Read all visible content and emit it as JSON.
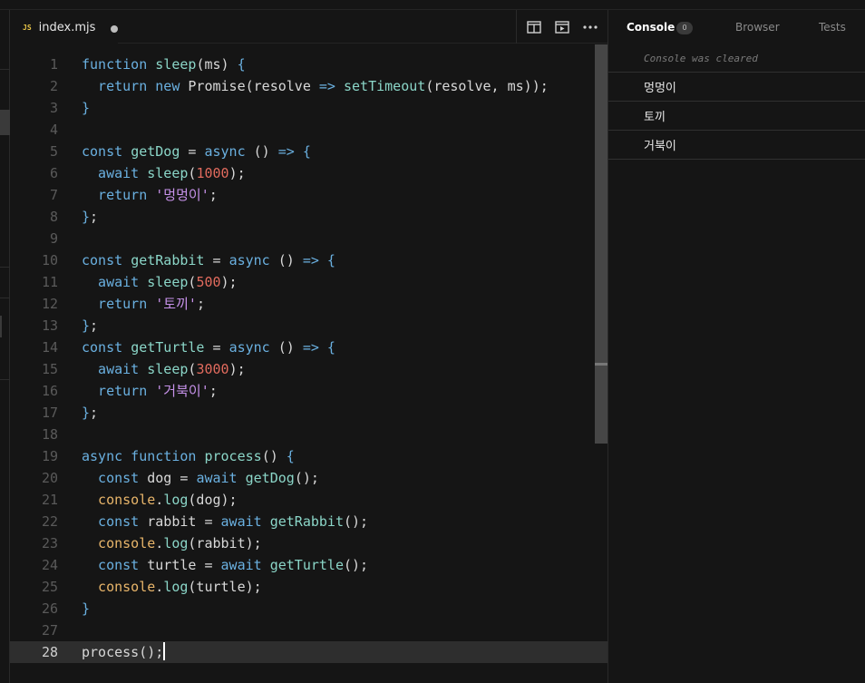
{
  "editor": {
    "tab": {
      "lang_badge": "JS",
      "filename": "index.mjs"
    },
    "actions": [
      "split-editor-icon",
      "open-preview-icon",
      "more-icon"
    ],
    "lines": [
      {
        "n": "1",
        "tokens": [
          [
            "kw",
            "function "
          ],
          [
            "fn",
            "sleep"
          ],
          [
            "cls",
            "(ms) "
          ],
          [
            "kw",
            "{"
          ]
        ]
      },
      {
        "n": "2",
        "tokens": [
          [
            "kw",
            "  return new "
          ],
          [
            "cls",
            "Promise(resolve "
          ],
          [
            "kw",
            "=> "
          ],
          [
            "fn",
            "setTimeout"
          ],
          [
            "cls",
            "(resolve, ms));"
          ]
        ]
      },
      {
        "n": "3",
        "tokens": [
          [
            "kw",
            "}"
          ]
        ]
      },
      {
        "n": "4",
        "tokens": []
      },
      {
        "n": "5",
        "tokens": [
          [
            "kw",
            "const "
          ],
          [
            "fn",
            "getDog "
          ],
          [
            "cls",
            "= "
          ],
          [
            "kw",
            "async "
          ],
          [
            "cls",
            "() "
          ],
          [
            "kw",
            "=> {"
          ]
        ]
      },
      {
        "n": "6",
        "tokens": [
          [
            "kw",
            "  await "
          ],
          [
            "fn",
            "sleep"
          ],
          [
            "cls",
            "("
          ],
          [
            "num",
            "1000"
          ],
          [
            "cls",
            ");"
          ]
        ]
      },
      {
        "n": "7",
        "tokens": [
          [
            "kw",
            "  return "
          ],
          [
            "str",
            "'멍멍이'"
          ],
          [
            "cls",
            ";"
          ]
        ]
      },
      {
        "n": "8",
        "tokens": [
          [
            "kw",
            "}"
          ],
          [
            "cls",
            ";"
          ]
        ]
      },
      {
        "n": "9",
        "tokens": []
      },
      {
        "n": "10",
        "tokens": [
          [
            "kw",
            "const "
          ],
          [
            "fn",
            "getRabbit "
          ],
          [
            "cls",
            "= "
          ],
          [
            "kw",
            "async "
          ],
          [
            "cls",
            "() "
          ],
          [
            "kw",
            "=> {"
          ]
        ]
      },
      {
        "n": "11",
        "tokens": [
          [
            "kw",
            "  await "
          ],
          [
            "fn",
            "sleep"
          ],
          [
            "cls",
            "("
          ],
          [
            "num",
            "500"
          ],
          [
            "cls",
            ");"
          ]
        ]
      },
      {
        "n": "12",
        "tokens": [
          [
            "kw",
            "  return "
          ],
          [
            "str",
            "'토끼'"
          ],
          [
            "cls",
            ";"
          ]
        ]
      },
      {
        "n": "13",
        "tokens": [
          [
            "kw",
            "}"
          ],
          [
            "cls",
            ";"
          ]
        ]
      },
      {
        "n": "14",
        "tokens": [
          [
            "kw",
            "const "
          ],
          [
            "fn",
            "getTurtle "
          ],
          [
            "cls",
            "= "
          ],
          [
            "kw",
            "async "
          ],
          [
            "cls",
            "() "
          ],
          [
            "kw",
            "=> {"
          ]
        ]
      },
      {
        "n": "15",
        "tokens": [
          [
            "kw",
            "  await "
          ],
          [
            "fn",
            "sleep"
          ],
          [
            "cls",
            "("
          ],
          [
            "num",
            "3000"
          ],
          [
            "cls",
            ");"
          ]
        ]
      },
      {
        "n": "16",
        "tokens": [
          [
            "kw",
            "  return "
          ],
          [
            "str",
            "'거북이'"
          ],
          [
            "cls",
            ";"
          ]
        ]
      },
      {
        "n": "17",
        "tokens": [
          [
            "kw",
            "}"
          ],
          [
            "cls",
            ";"
          ]
        ]
      },
      {
        "n": "18",
        "tokens": []
      },
      {
        "n": "19",
        "tokens": [
          [
            "kw",
            "async function "
          ],
          [
            "fn",
            "process"
          ],
          [
            "cls",
            "() "
          ],
          [
            "kw",
            "{"
          ]
        ]
      },
      {
        "n": "20",
        "tokens": [
          [
            "kw",
            "  const "
          ],
          [
            "cls",
            "dog = "
          ],
          [
            "kw",
            "await "
          ],
          [
            "fn",
            "getDog"
          ],
          [
            "cls",
            "();"
          ]
        ]
      },
      {
        "n": "21",
        "tokens": [
          [
            "cons",
            "  console"
          ],
          [
            "cls",
            "."
          ],
          [
            "fn",
            "log"
          ],
          [
            "cls",
            "(dog);"
          ]
        ]
      },
      {
        "n": "22",
        "tokens": [
          [
            "kw",
            "  const "
          ],
          [
            "cls",
            "rabbit = "
          ],
          [
            "kw",
            "await "
          ],
          [
            "fn",
            "getRabbit"
          ],
          [
            "cls",
            "();"
          ]
        ]
      },
      {
        "n": "23",
        "tokens": [
          [
            "cons",
            "  console"
          ],
          [
            "cls",
            "."
          ],
          [
            "fn",
            "log"
          ],
          [
            "cls",
            "(rabbit);"
          ]
        ]
      },
      {
        "n": "24",
        "tokens": [
          [
            "kw",
            "  const "
          ],
          [
            "cls",
            "turtle = "
          ],
          [
            "kw",
            "await "
          ],
          [
            "fn",
            "getTurtle"
          ],
          [
            "cls",
            "();"
          ]
        ]
      },
      {
        "n": "25",
        "tokens": [
          [
            "cons",
            "  console"
          ],
          [
            "cls",
            "."
          ],
          [
            "fn",
            "log"
          ],
          [
            "cls",
            "(turtle);"
          ]
        ]
      },
      {
        "n": "26",
        "tokens": [
          [
            "kw",
            "}"
          ]
        ]
      },
      {
        "n": "27",
        "tokens": []
      },
      {
        "n": "28",
        "tokens": [
          [
            "cls",
            "process();"
          ]
        ],
        "active": true
      }
    ]
  },
  "panel": {
    "tabs": [
      {
        "label": "Console",
        "active": true
      },
      {
        "label": "Browser",
        "active": false
      },
      {
        "label": "Tests",
        "active": false
      }
    ],
    "console_count": "0",
    "console": {
      "cleared_message": "Console was cleared",
      "logs": [
        "멍멍이",
        "토끼",
        "거북이"
      ]
    }
  },
  "colors": {
    "keyword": "#6ab0e0",
    "function": "#8bd6c8",
    "string": "#c792ea",
    "number": "#e26b5e",
    "console": "#e8b56a",
    "background": "#151515"
  }
}
